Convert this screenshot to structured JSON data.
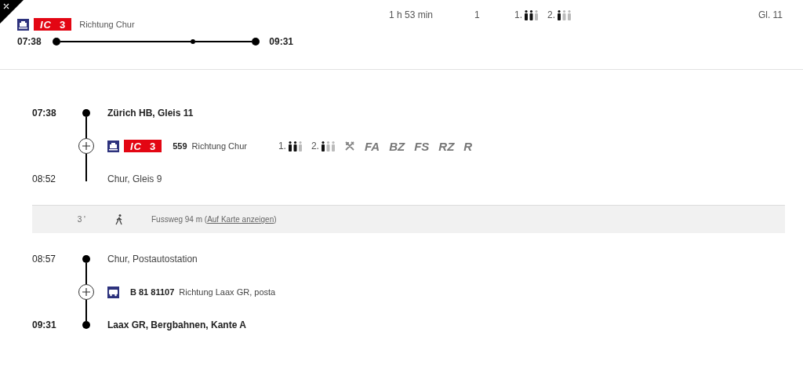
{
  "summary": {
    "product": {
      "kind": "train",
      "name": "IC",
      "number": "3"
    },
    "direction": "Richtung Chur",
    "departure": "07:38",
    "arrival": "09:31",
    "duration": "1 h 53 min",
    "changes": "1",
    "occupancy": [
      {
        "label": "1.",
        "figures": [
          {
            "filled": true
          },
          {
            "filled": true
          },
          {
            "filled": false
          }
        ]
      },
      {
        "label": "2.",
        "figures": [
          {
            "filled": true
          },
          {
            "filled": false
          },
          {
            "filled": false
          }
        ]
      }
    ],
    "platform": "Gl. 11"
  },
  "sections": [
    {
      "kind": "journey",
      "stops": [
        {
          "time": "07:38",
          "place": "Zürich HB, Gleis 11",
          "emphasized": true,
          "dot": true
        }
      ],
      "leg": {
        "kind": "train",
        "name": "IC",
        "number": "3",
        "line": "559",
        "direction": "Richtung Chur",
        "occupancy": [
          {
            "label": "1.",
            "figures": [
              {
                "filled": true
              },
              {
                "filled": true
              },
              {
                "filled": false
              }
            ]
          },
          {
            "label": "2.",
            "figures": [
              {
                "filled": true
              },
              {
                "filled": false
              },
              {
                "filled": false
              }
            ]
          }
        ],
        "attributes": [
          "FA",
          "BZ",
          "FS",
          "RZ",
          "R"
        ]
      },
      "end": {
        "time": "08:52",
        "place": "Chur, Gleis 9",
        "emphasized": false,
        "dot": false
      }
    },
    {
      "kind": "walk",
      "minutes": "3 '",
      "text": "Fussweg 94 m (",
      "link": "Auf Karte anzeigen",
      "text_end": ")"
    },
    {
      "kind": "journey",
      "stops": [
        {
          "time": "08:57",
          "place": "Chur, Postautostation",
          "emphasized": false,
          "dot": true
        }
      ],
      "leg": {
        "kind": "bus",
        "line": "B 81 81107",
        "direction": "Richtung Laax GR, posta"
      },
      "end": {
        "time": "09:31",
        "place": "Laax GR, Bergbahnen, Kante A",
        "emphasized": true,
        "dot": true
      }
    }
  ]
}
